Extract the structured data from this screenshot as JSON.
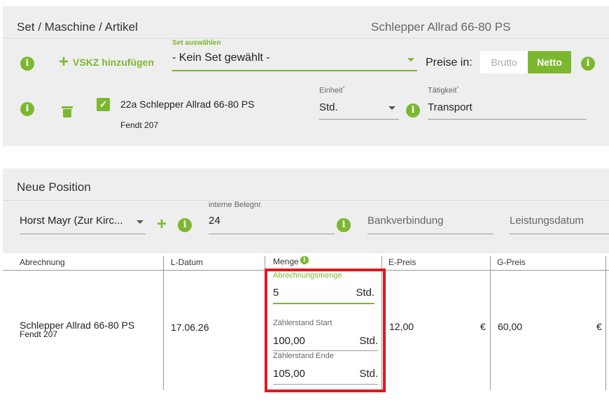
{
  "set_panel": {
    "title": "Set / Maschine / Artikel",
    "subtitle": "Schlepper Allrad 66-80 PS",
    "add_vskz_label": "VSKZ hinzufügen",
    "set_select_label": "Set auswählen",
    "set_select_value": "- Kein Set gewählt -",
    "prices_label": "Preise in:",
    "price_options": [
      "Brutto",
      "Netto"
    ],
    "price_selected": "Netto",
    "item": {
      "name": "22a Schlepper Allrad 66-80 PS",
      "brand": "Fendt 207",
      "checked": true,
      "unit_label": "Einheit",
      "unit_value": "Std.",
      "activity_label": "Tätigkeit",
      "activity_value": "Transport",
      "required_mark": "*"
    }
  },
  "position_panel": {
    "title": "Neue Position",
    "customer_value": "Horst Mayr (Zur Kirc...",
    "internal_no_label": "interne Belegnr.",
    "internal_no_value": "24",
    "bank_placeholder": "Bankverbindung",
    "service_date_placeholder": "Leistungsdatum",
    "table": {
      "headers": [
        "Abrechnung",
        "L-Datum",
        "Menge",
        "E-Preis",
        "G-Preis"
      ],
      "row": {
        "title": "Schlepper Allrad 66-80 PS",
        "subtitle": "Fendt 207",
        "date": "17.06.26",
        "billing_qty_label": "Abrechnungsmenge",
        "billing_qty_value": "5",
        "billing_qty_unit": "Std.",
        "counter_start_label": "Zählerstand Start",
        "counter_start_value": "100,00",
        "counter_start_unit": "Std.",
        "counter_end_label": "Zählerstand Ende",
        "counter_end_value": "105,00",
        "counter_end_unit": "Std.",
        "unit_price": "12,00",
        "unit_price_currency": "€",
        "total_price": "60,00",
        "total_price_currency": "€"
      }
    }
  },
  "colors": {
    "accent": "#7cb82f",
    "highlight": "#e2171e",
    "panel_bg": "#eeeeee"
  }
}
